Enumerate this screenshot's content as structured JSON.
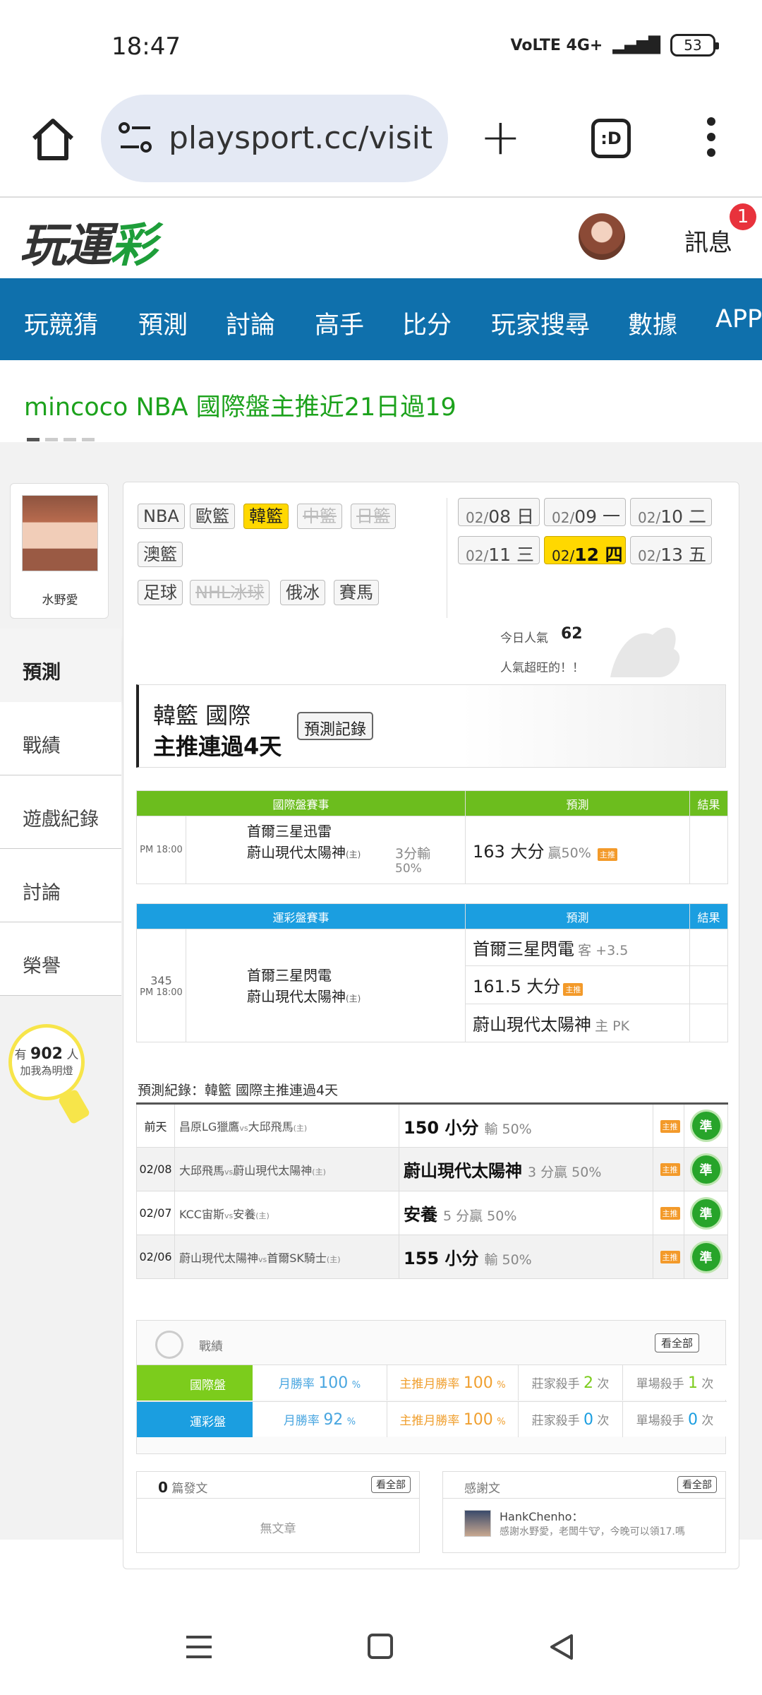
{
  "status": {
    "time": "18:47",
    "network": "VoLTE 4G+",
    "battery": "53"
  },
  "browser": {
    "url": "playsport.cc/visit"
  },
  "header": {
    "logo_a": "玩運",
    "logo_b": "彩",
    "msg_label": "訊息",
    "msg_badge": "1"
  },
  "nav": [
    "玩競猜",
    "預測",
    "討論",
    "高手",
    "比分",
    "玩家搜尋",
    "數據",
    "APP"
  ],
  "ticker": "mincoco NBA 國際盤主推近21日過19",
  "profile": {
    "name": "水野愛"
  },
  "side_menu": [
    "預測",
    "戰績",
    "遊戲紀錄",
    "討論",
    "榮譽"
  ],
  "fans": {
    "pre": "有",
    "count": "902",
    "post": "人",
    "note": "加我為明燈"
  },
  "leagues": {
    "row1": [
      "NBA",
      "歐籃",
      "韓籃",
      "中籃",
      "日籃"
    ],
    "row2": [
      "澳籃"
    ],
    "row3": [
      "足球",
      "NHL冰球",
      "俄冰",
      "賽馬"
    ]
  },
  "dates": [
    {
      "m": "02/",
      "d": "08 日"
    },
    {
      "m": "02/",
      "d": "09 一"
    },
    {
      "m": "02/",
      "d": "10 二"
    },
    {
      "m": "02/",
      "d": "11 三"
    },
    {
      "m": "02/",
      "d": "12 四"
    },
    {
      "m": "02/",
      "d": "13 五"
    }
  ],
  "popularity": {
    "label": "今日人氣",
    "value": "62",
    "note": "人氣超旺的！！"
  },
  "streak": {
    "line1": "韓籃 國際",
    "line2": "主推連過4天",
    "btn": "預測記錄"
  },
  "intl_table": {
    "h_match": "國際盤賽事",
    "h_pred": "預測",
    "h_result": "結果",
    "time": "PM 18:00",
    "away": "首爾三星迅雷",
    "home": "蔚山現代太陽神",
    "home_tag": "(主)",
    "note1": "3分輸",
    "note2": "50%",
    "pred": "163 大分",
    "pred_sub": "贏50%",
    "zhu": "主推"
  },
  "lottery_table": {
    "h_match": "運彩盤賽事",
    "h_pred": "預測",
    "h_result": "結果",
    "num": "345",
    "time": "PM 18:00",
    "away": "首爾三星閃電",
    "home": "蔚山現代太陽神",
    "home_tag": "(主)",
    "preds": [
      {
        "main": "首爾三星閃電",
        "sub": "客 +3.5",
        "zhu": ""
      },
      {
        "main": "161.5 大分",
        "sub": "",
        "zhu": "主推"
      },
      {
        "main": "蔚山現代太陽神",
        "sub": "主 PK",
        "zhu": ""
      }
    ]
  },
  "history": {
    "title": "預測紀錄：韓籃 國際主推連過4天",
    "rows": [
      {
        "day": "前天",
        "a": "昌原LG獵鷹",
        "vs": "vs",
        "b": "大邱飛馬",
        "tag": "(主)",
        "pred": "150 小分",
        "res": "輸 50%",
        "zhu": "主推",
        "mark": "準"
      },
      {
        "day": "02/08",
        "a": "大邱飛馬",
        "vs": "vs",
        "b": "蔚山現代太陽神",
        "tag": "(主)",
        "pred": "蔚山現代太陽神",
        "res": "3 分贏 50%",
        "zhu": "主推",
        "mark": "準"
      },
      {
        "day": "02/07",
        "a": "KCC宙斯",
        "vs": "vs",
        "b": "安養",
        "tag": "(主)",
        "pred": "安養",
        "res": "5 分贏 50%",
        "zhu": "主推",
        "mark": "準"
      },
      {
        "day": "02/06",
        "a": "蔚山現代太陽神",
        "vs": "vs",
        "b": "首爾SK騎士",
        "tag": "(主)",
        "pred": "155 小分",
        "res": "輸 50%",
        "zhu": "主推",
        "mark": "準"
      }
    ]
  },
  "record": {
    "title": "戰績",
    "all": "看全部",
    "rows": [
      {
        "label": "國際盤",
        "c1": "月勝率",
        "v1": "100",
        "u1": "%",
        "c2": "主推月勝率",
        "v2": "100",
        "u2": "%",
        "c3": "莊家殺手",
        "v3": "2",
        "u3": "次",
        "c4": "單場殺手",
        "v4": "1",
        "u4": "次"
      },
      {
        "label": "運彩盤",
        "c1": "月勝率",
        "v1": "92",
        "u1": "%",
        "c2": "主推月勝率",
        "v2": "100",
        "u2": "%",
        "c3": "莊家殺手",
        "v3": "0",
        "u3": "次",
        "c4": "單場殺手",
        "v4": "0",
        "u4": "次"
      }
    ],
    "colors": {
      "intl": "#7ccc1c",
      "lottery": "#1b9ee0",
      "rate": "#49a6e0",
      "zhu": "#f0a030"
    }
  },
  "posts": {
    "count": "0",
    "label": "篇發文",
    "all": "看全部",
    "empty": "無文章"
  },
  "thanks": {
    "label": "感謝文",
    "all": "看全部",
    "user": "HankChenho：",
    "text": "感謝水野愛，老闆牛🐮，今晚可以領17.嗎"
  }
}
